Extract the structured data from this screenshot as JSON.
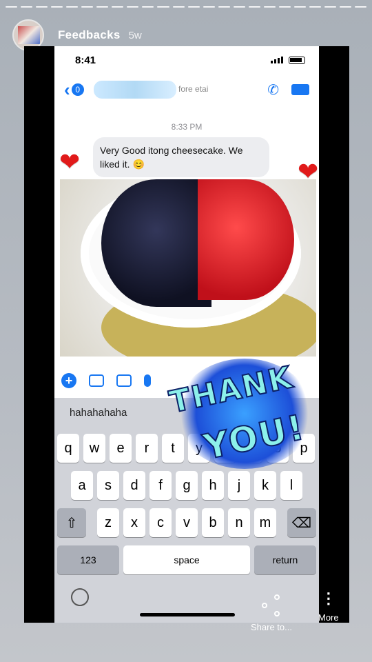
{
  "story": {
    "title": "Feedbacks",
    "age": "5w",
    "progress_segments": 24
  },
  "phone": {
    "status_time": "8:41",
    "chat": {
      "back_count": "0",
      "subtitle": "fore etai",
      "timestamp": "8:33 PM",
      "message": "Very Good itong cheesecake. We liked it. 😊"
    },
    "suggestions": [
      "hahahahaha",
      "",
      "thank"
    ],
    "keys": {
      "row1": [
        "q",
        "w",
        "e",
        "r",
        "t",
        "y",
        "u",
        "i",
        "o",
        "p"
      ],
      "row2": [
        "a",
        "s",
        "d",
        "f",
        "g",
        "h",
        "j",
        "k",
        "l"
      ],
      "row3": [
        "z",
        "x",
        "c",
        "v",
        "b",
        "n",
        "m"
      ],
      "numbers": "123",
      "space": "space",
      "return": "return"
    }
  },
  "sticker": {
    "line1": "THANK",
    "line2": "YOU!"
  },
  "actions": {
    "share_label": "Share to...",
    "more_label": "More"
  },
  "colors": {
    "messenger_blue": "#1877f2",
    "heart_red": "#e11a1a"
  }
}
